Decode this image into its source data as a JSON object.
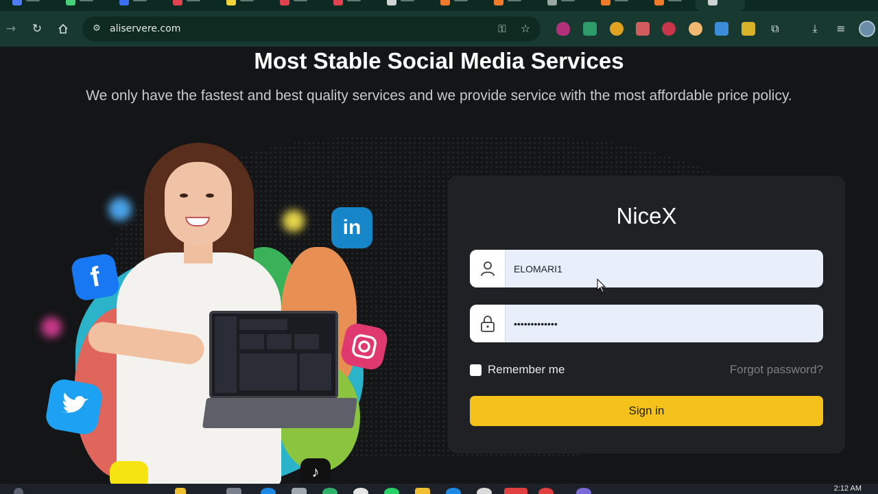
{
  "browser": {
    "url": "aliservere.com"
  },
  "page": {
    "headline": "Most Stable Social Media Services",
    "subheadline": "We only have the fastest and best quality services and we provide service with the most affordable price policy.",
    "social_icons": [
      "facebook-icon",
      "linkedin-icon",
      "instagram-icon",
      "twitter-icon",
      "tiktok-icon",
      "snapchat-icon"
    ]
  },
  "login": {
    "brand": "NiceX",
    "username_value": "ELOMARI1",
    "password_value": "•••••••••••••",
    "remember_label": "Remember me",
    "forgot_label": "Forgot password?",
    "signin_label": "Sign in",
    "accent_color": "#f5c21b"
  },
  "taskbar": {
    "clock": "2:12 AM"
  }
}
